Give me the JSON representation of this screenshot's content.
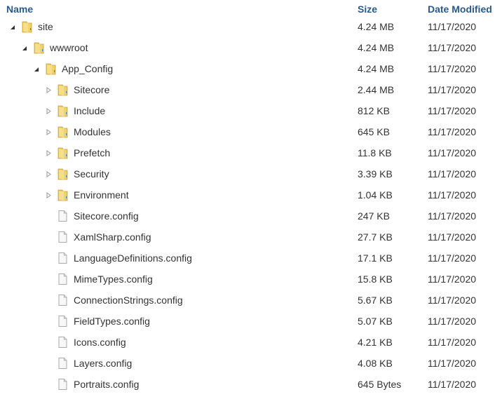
{
  "columns": {
    "name": "Name",
    "size": "Size",
    "date": "Date Modified"
  },
  "colors": {
    "header": "#2a5a8c",
    "text": "#333333",
    "folder": "#f2d873"
  },
  "rows": [
    {
      "name": "site",
      "type": "folder",
      "level": 0,
      "state": "expanded",
      "size": "4.24 MB",
      "date": "11/17/2020"
    },
    {
      "name": "wwwroot",
      "type": "folder",
      "level": 1,
      "state": "expanded",
      "size": "4.24 MB",
      "date": "11/17/2020"
    },
    {
      "name": "App_Config",
      "type": "folder",
      "level": 2,
      "state": "expanded",
      "size": "4.24 MB",
      "date": "11/17/2020"
    },
    {
      "name": "Sitecore",
      "type": "folder",
      "level": 3,
      "state": "collapsed",
      "size": "2.44 MB",
      "date": "11/17/2020"
    },
    {
      "name": "Include",
      "type": "folder",
      "level": 3,
      "state": "collapsed",
      "size": "812 KB",
      "date": "11/17/2020"
    },
    {
      "name": "Modules",
      "type": "folder",
      "level": 3,
      "state": "collapsed",
      "size": "645 KB",
      "date": "11/17/2020"
    },
    {
      "name": "Prefetch",
      "type": "folder",
      "level": 3,
      "state": "collapsed",
      "size": "11.8 KB",
      "date": "11/17/2020"
    },
    {
      "name": "Security",
      "type": "folder",
      "level": 3,
      "state": "collapsed",
      "size": "3.39 KB",
      "date": "11/17/2020"
    },
    {
      "name": "Environment",
      "type": "folder",
      "level": 3,
      "state": "collapsed",
      "size": "1.04 KB",
      "date": "11/17/2020"
    },
    {
      "name": "Sitecore.config",
      "type": "file",
      "level": 3,
      "size": "247 KB",
      "date": "11/17/2020"
    },
    {
      "name": "XamlSharp.config",
      "type": "file",
      "level": 3,
      "size": "27.7 KB",
      "date": "11/17/2020"
    },
    {
      "name": "LanguageDefinitions.config",
      "type": "file",
      "level": 3,
      "size": "17.1 KB",
      "date": "11/17/2020"
    },
    {
      "name": "MimeTypes.config",
      "type": "file",
      "level": 3,
      "size": "15.8 KB",
      "date": "11/17/2020"
    },
    {
      "name": "ConnectionStrings.config",
      "type": "file",
      "level": 3,
      "size": "5.67 KB",
      "date": "11/17/2020"
    },
    {
      "name": "FieldTypes.config",
      "type": "file",
      "level": 3,
      "size": "5.07 KB",
      "date": "11/17/2020"
    },
    {
      "name": "Icons.config",
      "type": "file",
      "level": 3,
      "size": "4.21 KB",
      "date": "11/17/2020"
    },
    {
      "name": "Layers.config",
      "type": "file",
      "level": 3,
      "size": "4.08 KB",
      "date": "11/17/2020"
    },
    {
      "name": "Portraits.config",
      "type": "file",
      "level": 3,
      "size": "645 Bytes",
      "date": "11/17/2020"
    }
  ]
}
